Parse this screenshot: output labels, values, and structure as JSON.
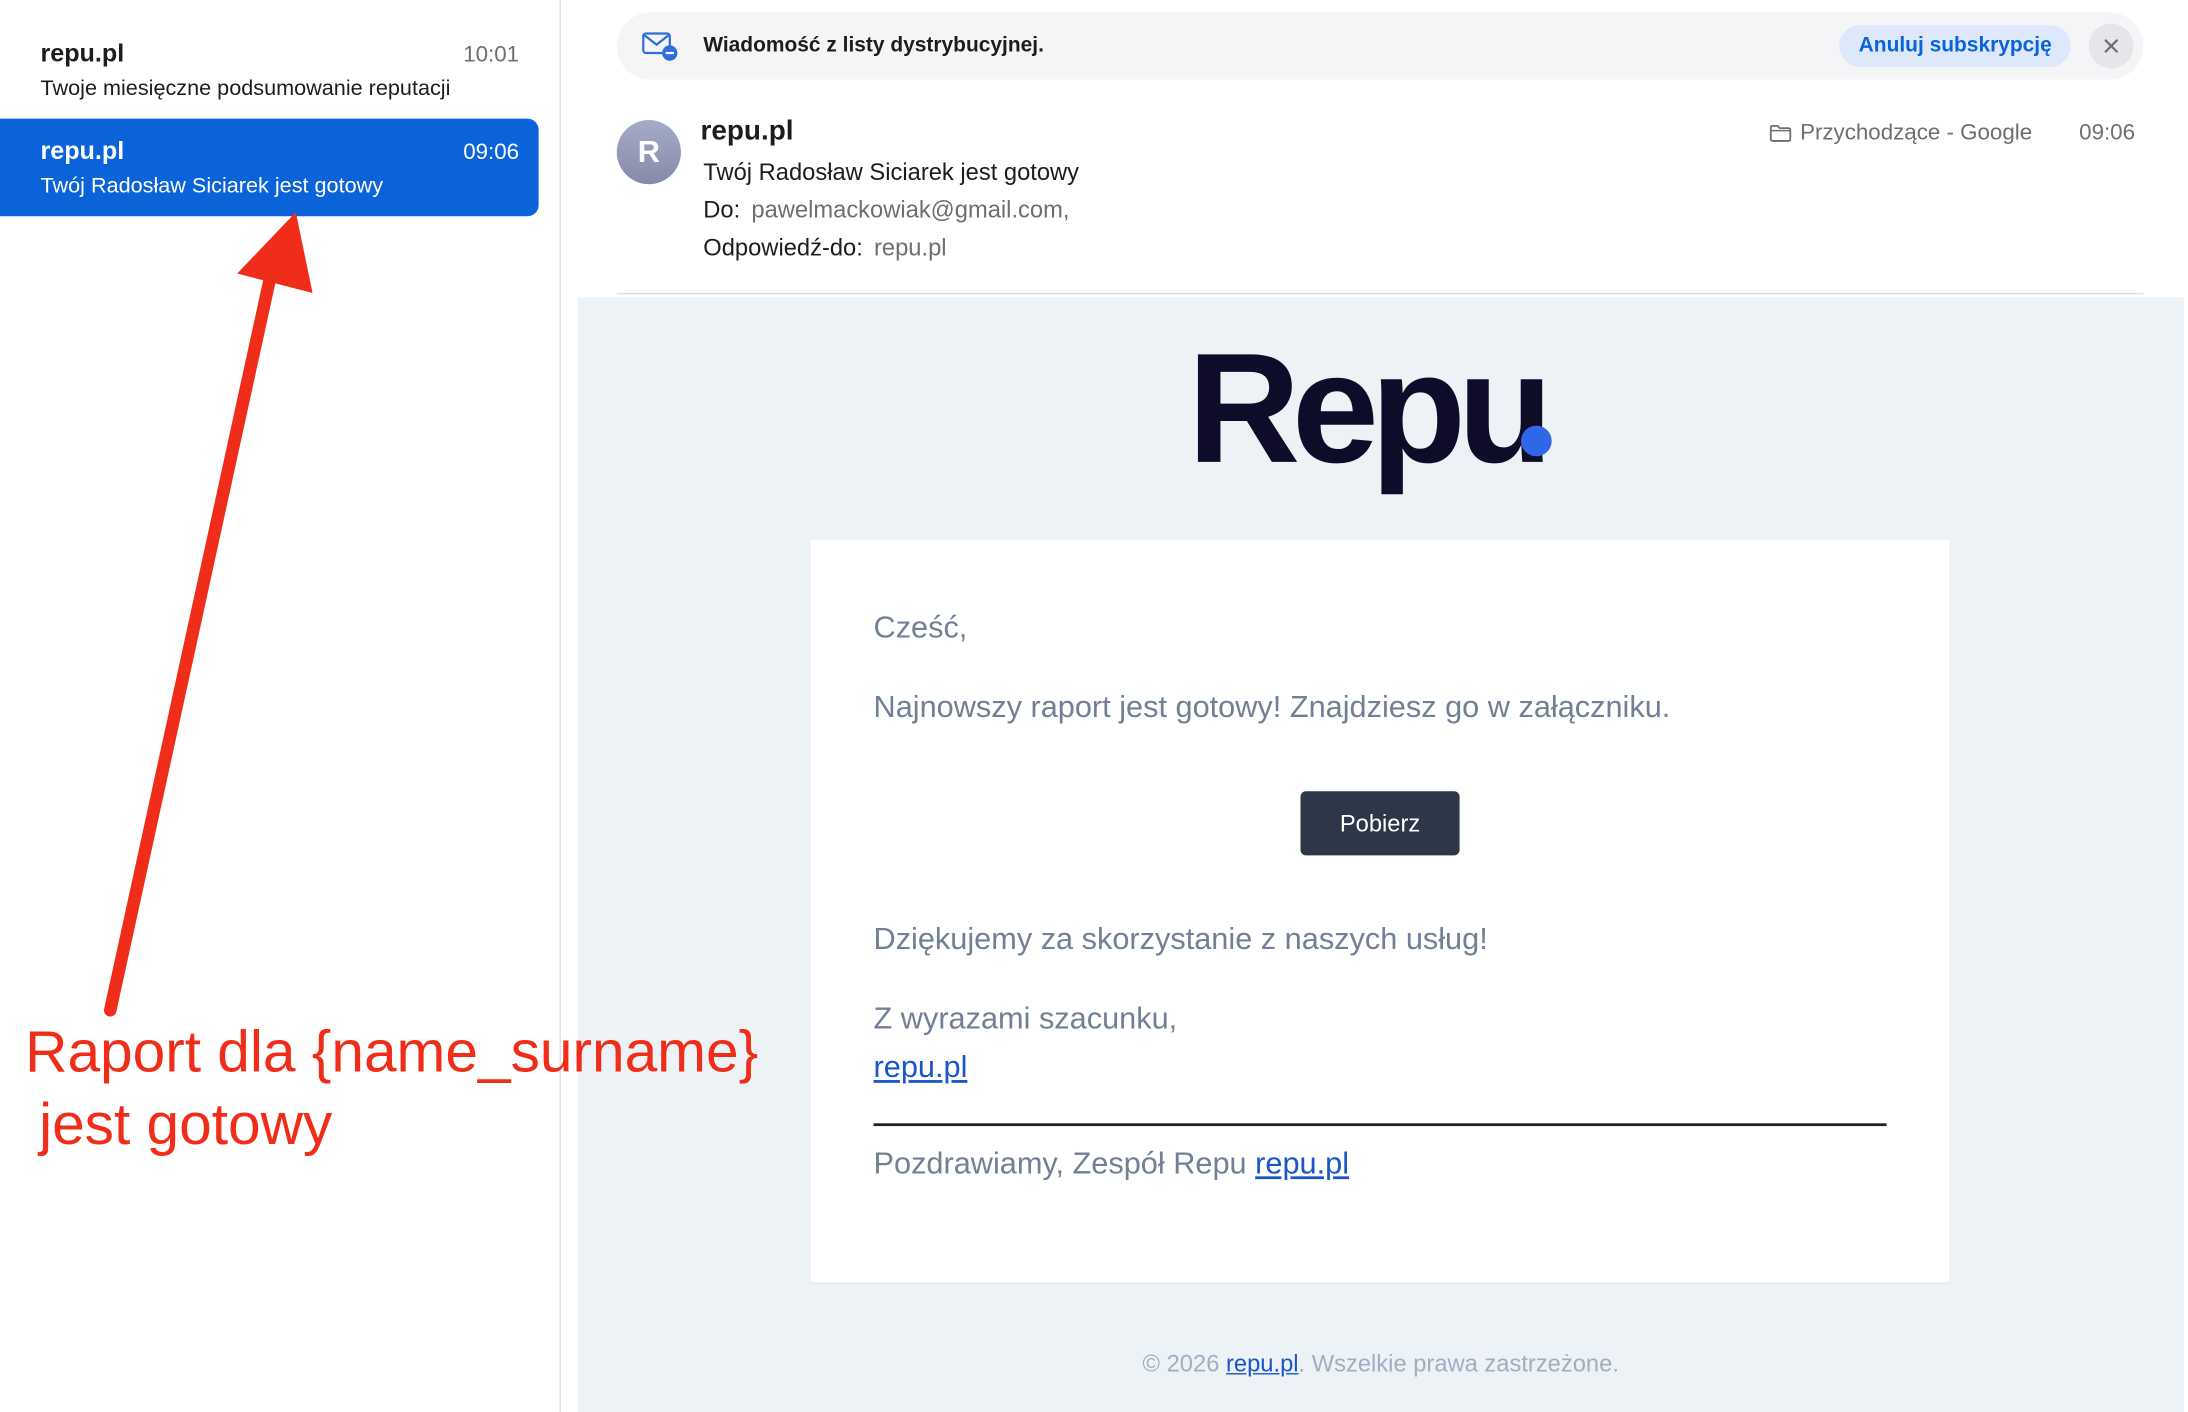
{
  "message_list": [
    {
      "sender": "repu.pl",
      "time": "10:01",
      "subject": "Twoje miesięczne podsumowanie reputacji",
      "selected": false
    },
    {
      "sender": "repu.pl",
      "time": "09:06",
      "subject": "Twój Radosław Siciarek jest gotowy",
      "selected": true
    }
  ],
  "banner": {
    "text": "Wiadomość z listy dystrybucyjnej.",
    "unsubscribe_label": "Anuluj subskrypcję"
  },
  "header": {
    "avatar_letter": "R",
    "from": "repu.pl",
    "subject": "Twój Radosław Siciarek jest gotowy",
    "to_label": "Do:",
    "to_value": "pawelmackowiak@gmail.com,",
    "reply_to_label": "Odpowiedź-do:",
    "reply_to_value": "repu.pl",
    "folder": "Przychodzące - Google",
    "time": "09:06"
  },
  "email": {
    "logo_text": "Repu",
    "greeting": "Cześć,",
    "intro": "Najnowszy raport jest gotowy! Znajdziesz go w załączniku.",
    "download_button": "Pobierz",
    "thanks": "Dziękujemy za skorzystanie z naszych usług!",
    "regards": "Z wyrazami szacunku,",
    "signature_link": "repu.pl",
    "footer_text": "Pozdrawiamy, Zespół Repu",
    "footer_link": "repu.pl",
    "copyright_prefix": "© 2026",
    "copyright_link": "repu.pl",
    "copyright_suffix": ". Wszelkie prawa zastrzeżone."
  },
  "annotation": {
    "line1": "Raport dla {name_surname}",
    "line2": "jest gotowy",
    "color": "#f02d18"
  },
  "colors": {
    "accent": "#0a63d9",
    "logo": "#0f0c29",
    "logo_dot": "#2e67e8",
    "email_bg": "#edf2f7",
    "button_dark": "#2d3748"
  }
}
